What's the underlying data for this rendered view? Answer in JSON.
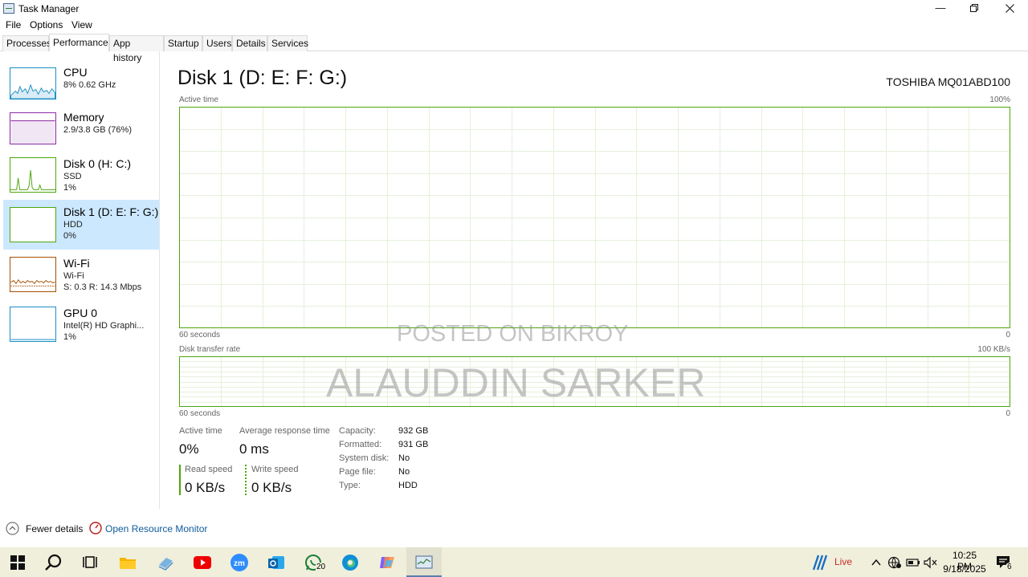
{
  "window": {
    "title": "Task Manager"
  },
  "menu": [
    "File",
    "Options",
    "View"
  ],
  "tabs": [
    "Processes",
    "Performance",
    "App history",
    "Startup",
    "Users",
    "Details",
    "Services"
  ],
  "sidebar": {
    "items": [
      {
        "name": "CPU",
        "line1": "8% 0.62 GHz",
        "line2": ""
      },
      {
        "name": "Memory",
        "line1": "2.9/3.8 GB (76%)",
        "line2": ""
      },
      {
        "name": "Disk 0 (H: C:)",
        "line1": "SSD",
        "line2": "1%"
      },
      {
        "name": "Disk 1 (D: E: F: G:)",
        "line1": "HDD",
        "line2": "0%"
      },
      {
        "name": "Wi-Fi",
        "line1": "Wi-Fi",
        "line2": "S: 0.3  R: 14.3 Mbps"
      },
      {
        "name": "GPU 0",
        "line1": "Intel(R) HD Graphi...",
        "line2": "1%"
      }
    ]
  },
  "main": {
    "title": "Disk 1 (D: E: F: G:)",
    "model": "TOSHIBA MQ01ABD100",
    "active_chart": {
      "label": "Active time",
      "max": "100%",
      "span": "60 seconds",
      "min": "0"
    },
    "transfer_chart": {
      "label": "Disk transfer rate",
      "max": "100 KB/s",
      "span": "60 seconds",
      "min": "0"
    },
    "stats": {
      "active_time_label": "Active time",
      "active_time_value": "0%",
      "avg_resp_label": "Average response time",
      "avg_resp_value": "0 ms",
      "read_label": "Read speed",
      "read_value": "0 KB/s",
      "write_label": "Write speed",
      "write_value": "0 KB/s"
    },
    "details": [
      {
        "k": "Capacity:",
        "v": "932 GB"
      },
      {
        "k": "Formatted:",
        "v": "931 GB"
      },
      {
        "k": "System disk:",
        "v": "No"
      },
      {
        "k": "Page file:",
        "v": "No"
      },
      {
        "k": "Type:",
        "v": "HDD"
      }
    ]
  },
  "footer": {
    "fewer": "Fewer details",
    "resmon": "Open Resource Monitor"
  },
  "taskbar": {
    "live": "Live",
    "time": "10:25 PM",
    "date": "9/18/2025",
    "whatsapp_badge": "20",
    "notif_badge": "6"
  },
  "watermarks": [
    "POSTED ON BIKROY",
    "ALAUDDIN SARKER"
  ],
  "colors": {
    "disk": "#4da60c",
    "cpu": "#1b8fc4",
    "memory": "#8b2ba4",
    "wifi": "#a74f01",
    "selected": "#cce8ff",
    "link": "#0f5a9b"
  }
}
